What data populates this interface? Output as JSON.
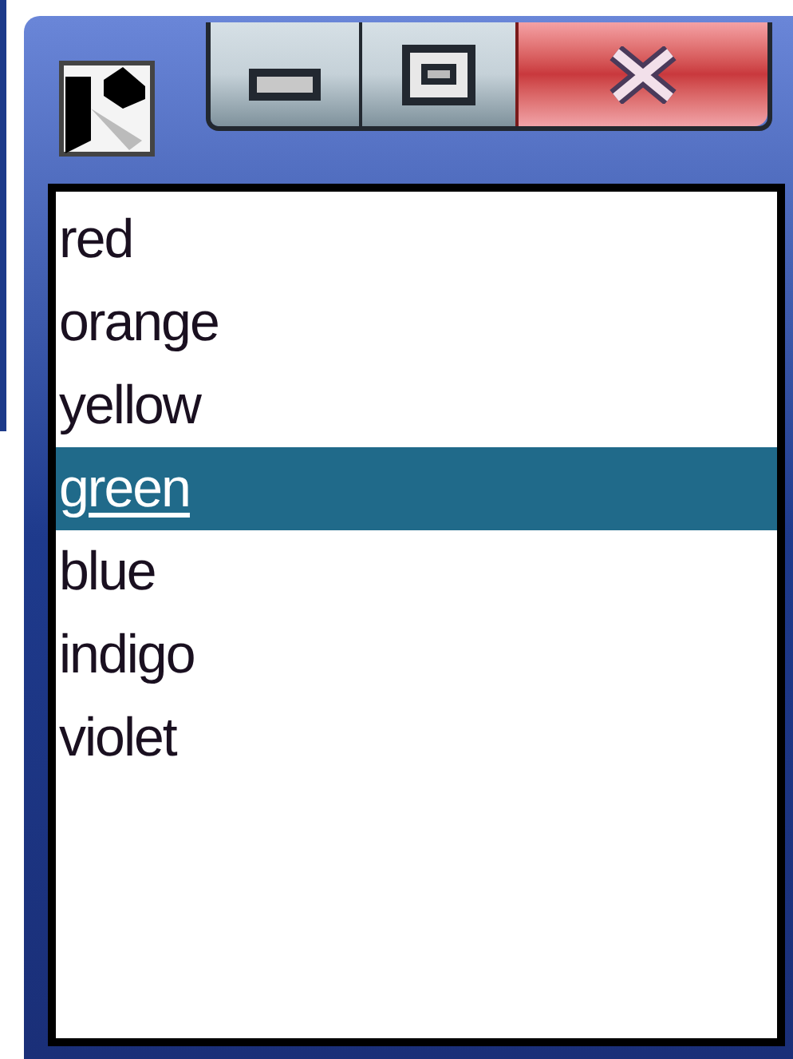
{
  "window": {
    "buttons": [
      {
        "kind": "minimize"
      },
      {
        "kind": "maximize"
      },
      {
        "kind": "close"
      }
    ]
  },
  "list": {
    "items": [
      {
        "label": "red",
        "selected": false
      },
      {
        "label": "orange",
        "selected": false
      },
      {
        "label": "yellow",
        "selected": false
      },
      {
        "label": "green",
        "selected": true
      },
      {
        "label": "blue",
        "selected": false
      },
      {
        "label": "indigo",
        "selected": false
      },
      {
        "label": "violet",
        "selected": false
      }
    ]
  }
}
